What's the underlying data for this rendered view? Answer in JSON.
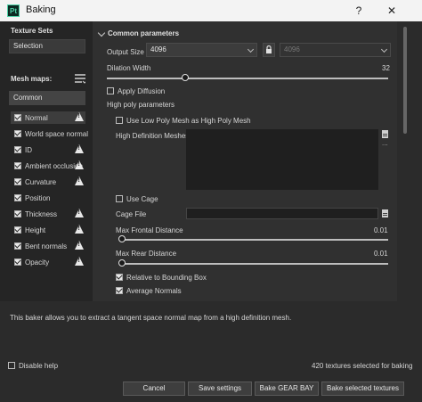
{
  "window": {
    "app_icon": "Pt",
    "title": "Baking",
    "help": "?",
    "close": "✕"
  },
  "left": {
    "texture_sets_title": "Texture Sets",
    "texture_set": "Selection",
    "mesh_maps_title": "Mesh maps:",
    "common_label": "Common",
    "maps": [
      {
        "label": "Normal",
        "checked": true,
        "warning": true
      },
      {
        "label": "World space normal",
        "checked": true,
        "warning": false
      },
      {
        "label": "ID",
        "checked": true,
        "warning": true
      },
      {
        "label": "Ambient occlusion",
        "checked": true,
        "warning": true
      },
      {
        "label": "Curvature",
        "checked": true,
        "warning": true
      },
      {
        "label": "Position",
        "checked": true,
        "warning": false
      },
      {
        "label": "Thickness",
        "checked": true,
        "warning": true
      },
      {
        "label": "Height",
        "checked": true,
        "warning": true
      },
      {
        "label": "Bent normals",
        "checked": true,
        "warning": true
      },
      {
        "label": "Opacity",
        "checked": true,
        "warning": true
      }
    ]
  },
  "common": {
    "section_title": "Common parameters",
    "output_size_label": "Output Size",
    "output_size": "4096",
    "output_size_locked": "4096",
    "dilation_label": "Dilation Width",
    "dilation_value": "32",
    "dilation_fraction": 0.28,
    "apply_diffusion_label": "Apply Diffusion",
    "apply_diffusion_checked": false,
    "high_poly_title": "High poly parameters",
    "use_low_poly_label": "Use Low Poly Mesh as High Poly Mesh",
    "use_low_poly_checked": false,
    "hd_meshes_label": "High Definition Meshes",
    "hd_meshes_more": "...",
    "use_cage_label": "Use Cage",
    "use_cage_checked": false,
    "cage_file_label": "Cage File",
    "max_frontal_label": "Max Frontal Distance",
    "max_frontal_value": "0.01",
    "max_frontal_fraction": 0.01,
    "max_rear_label": "Max Rear Distance",
    "max_rear_value": "0.01",
    "max_rear_fraction": 0.01,
    "relative_bbox_label": "Relative to Bounding Box",
    "relative_bbox_checked": true,
    "average_normals_label": "Average Normals",
    "average_normals_checked": true
  },
  "info_text": "This baker allows you to extract a tangent space normal map from a high definition mesh.",
  "footer": {
    "disable_help_label": "Disable help",
    "textures_selected": "420 textures selected for baking",
    "cancel": "Cancel",
    "save_settings": "Save settings",
    "bake_gear": "Bake GEAR BAY",
    "bake_selected": "Bake selected textures"
  },
  "colors": {
    "accent": "#4fd1a7",
    "panel": "#303030",
    "dark": "#252525"
  }
}
